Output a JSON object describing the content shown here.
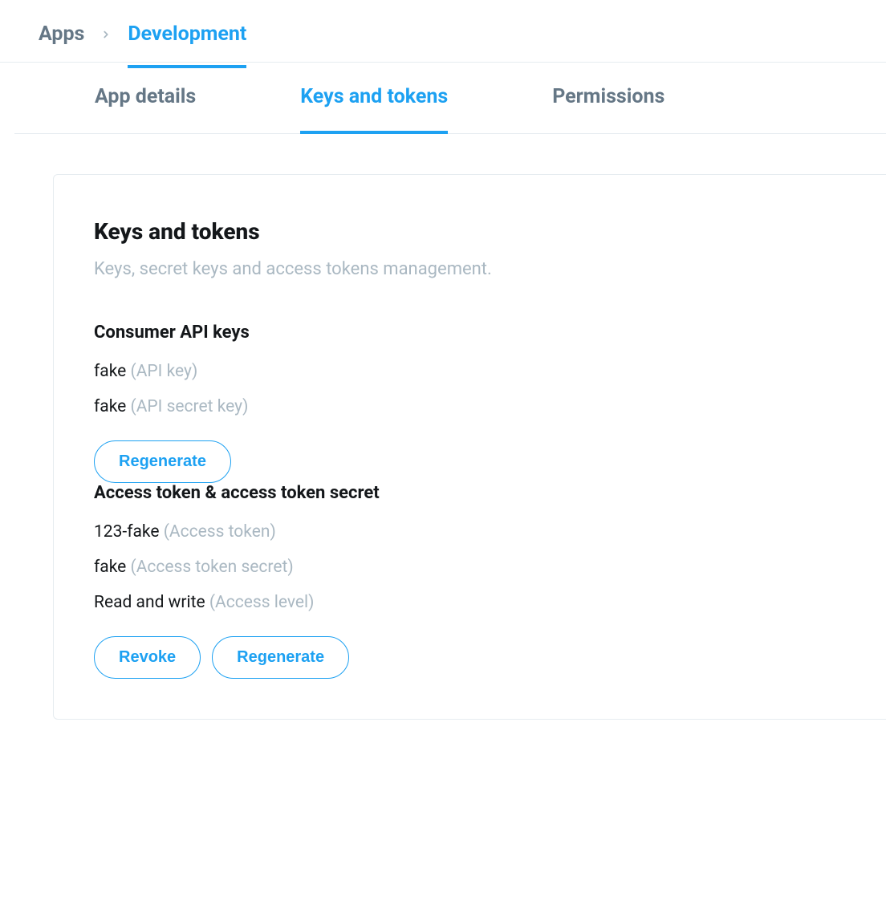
{
  "breadcrumb": {
    "root": "Apps",
    "current": "Development"
  },
  "tabs": {
    "app_details": "App details",
    "keys_tokens": "Keys and tokens",
    "permissions": "Permissions"
  },
  "card": {
    "title": "Keys and tokens",
    "subtitle": "Keys, secret keys and access tokens management."
  },
  "consumer": {
    "heading": "Consumer API keys",
    "api_key_value": "fake",
    "api_key_label": "(API key)",
    "api_secret_value": "fake",
    "api_secret_label": "(API secret key)",
    "regenerate": "Regenerate"
  },
  "access": {
    "heading": "Access token & access token secret",
    "token_value": "123-fake",
    "token_label": "(Access token)",
    "secret_value": "fake",
    "secret_label": "(Access token secret)",
    "level_value": "Read and write",
    "level_label": "(Access level)",
    "revoke": "Revoke",
    "regenerate": "Regenerate"
  }
}
